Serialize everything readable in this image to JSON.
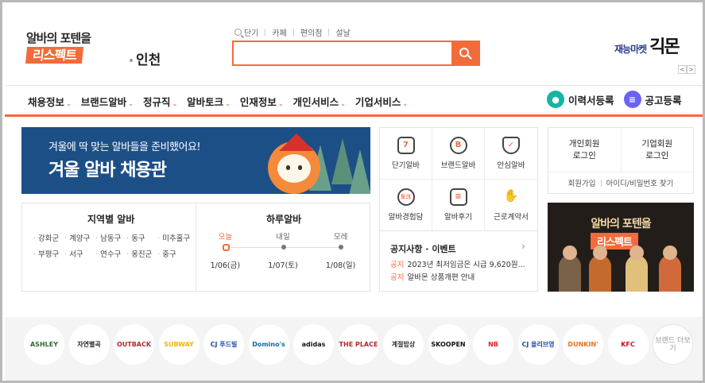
{
  "header": {
    "logo_top": "알바의 포텐을",
    "logo_bottom": "리스펙트",
    "region": "인천",
    "quick_links": [
      "단기",
      "카페",
      "편의점",
      "설날"
    ],
    "search_placeholder": "",
    "ad_label_small": "재능마켓",
    "ad_label_big": "긱몬",
    "ad_prev": "<",
    "ad_next": ">"
  },
  "nav": {
    "items": [
      "채용정보",
      "브랜드알바",
      "정규직",
      "알바토크",
      "인재정보",
      "개인서비스",
      "기업서비스"
    ],
    "resume_register": "이력서등록",
    "job_post_register": "공고등록"
  },
  "banner": {
    "line1": "겨울에 딱 맞는 알바들을 준비했어요!",
    "line2": "겨울 알바 채용관"
  },
  "region_box": {
    "title": "지역별 알바",
    "districts": [
      "강화군",
      "계양구",
      "남동구",
      "동구",
      "미추홀구",
      "부평구",
      "서구",
      "연수구",
      "옹진군",
      "중구"
    ]
  },
  "day_box": {
    "title": "하루알바",
    "days": [
      "오늘",
      "내일",
      "모레"
    ],
    "dates": [
      "1/06(금)",
      "1/07(토)",
      "1/08(일)"
    ]
  },
  "icon_menu": [
    {
      "label": "단기알바",
      "icon": "calendar-7-icon",
      "glyph": "7"
    },
    {
      "label": "브랜드알바",
      "icon": "brand-b-icon",
      "glyph": "B"
    },
    {
      "label": "안심알바",
      "icon": "shield-check-icon",
      "glyph": "✓"
    },
    {
      "label": "알바경험담",
      "icon": "talk-bubble-icon",
      "glyph": "토크"
    },
    {
      "label": "알바후기",
      "icon": "review-board-icon",
      "glyph": "≡"
    },
    {
      "label": "근로계약서",
      "icon": "handshake-icon",
      "glyph": "✋"
    }
  ],
  "notice": {
    "title": "공지사항 · 이벤트",
    "items": [
      {
        "category": "공지",
        "text": "2023년 최저임금은 시급 9,620원..."
      },
      {
        "category": "공지",
        "text": "알바몬 상품개편 안내"
      }
    ]
  },
  "login": {
    "personal_line1": "개인회원",
    "personal_line2": "로그인",
    "corporate_line1": "기업회원",
    "corporate_line2": "로그인",
    "signup": "회원가입",
    "find": "아이디/비밀번호 찾기"
  },
  "promo": {
    "line1": "알바의 포텐을",
    "line2": "리스펙트"
  },
  "brands": [
    {
      "name": "ASHLEY",
      "color": "#2f6b2f"
    },
    {
      "name": "자연별곡",
      "color": "#222222"
    },
    {
      "name": "OUTBACK",
      "color": "#b3282d"
    },
    {
      "name": "SUBWAY",
      "color": "#f2b705"
    },
    {
      "name": "CJ 푸드빌",
      "color": "#1f4aa8"
    },
    {
      "name": "Domino's",
      "color": "#0a6aa1"
    },
    {
      "name": "adidas",
      "color": "#111111"
    },
    {
      "name": "THE PLACE",
      "color": "#b3282d"
    },
    {
      "name": "계절밥상",
      "color": "#333333"
    },
    {
      "name": "SKOOPEN",
      "color": "#111111"
    },
    {
      "name": "NB",
      "color": "#d9222a"
    },
    {
      "name": "CJ 올리브영",
      "color": "#1f4aa8"
    },
    {
      "name": "DUNKIN'",
      "color": "#e8731e"
    },
    {
      "name": "KFC",
      "color": "#c8102e"
    },
    {
      "name": "브랜드 더보기",
      "color": "#999999"
    }
  ],
  "colors": {
    "accent": "#f36b3a",
    "banner": "#1d4f87",
    "resume": "#13b5a1",
    "post": "#6b63f0"
  }
}
